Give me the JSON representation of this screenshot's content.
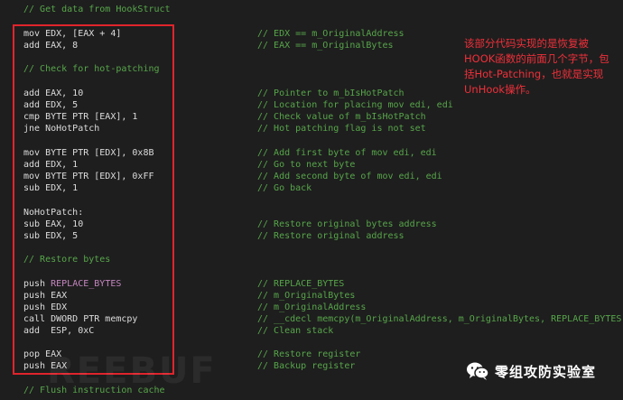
{
  "code_lines": [
    {
      "code": "// Get data from HookStruct",
      "comment": ""
    },
    {
      "code": "mov EDX, [EAX + 4]",
      "comment": "// EDX == m_OriginalAddress"
    },
    {
      "code": "add EAX, 8",
      "comment": "// EAX == m_OriginalBytes"
    },
    {
      "code": "// Check for hot-patching",
      "comment": ""
    },
    {
      "code": "add EAX, 10",
      "comment": "// Pointer to m_bIsHotPatch"
    },
    {
      "code": "add EDX, 5",
      "comment": "// Location for placing mov edi, edi"
    },
    {
      "code": "cmp BYTE PTR [EAX], 1",
      "comment": "// Check value of m_bIsHotPatch"
    },
    {
      "code": "jne NoHotPatch",
      "comment": "// Hot patching flag is not set"
    },
    {
      "code": "mov BYTE PTR [EDX], 0x8B",
      "comment": "// Add first byte of mov edi, edi"
    },
    {
      "code": "add EDX, 1",
      "comment": "// Go to next byte"
    },
    {
      "code": "mov BYTE PTR [EDX], 0xFF",
      "comment": "// Add second byte of mov edi, edi"
    },
    {
      "code": "sub EDX, 1",
      "comment": "// Go back"
    },
    {
      "code": "NoHotPatch:",
      "comment": ""
    },
    {
      "code": "sub EAX, 10",
      "comment": "// Restore original bytes address"
    },
    {
      "code": "sub EDX, 5",
      "comment": "// Restore original address"
    },
    {
      "code": "// Restore bytes",
      "comment": ""
    },
    {
      "code": "push ",
      "code_kw": "REPLACE_BYTES",
      "comment": "// REPLACE_BYTES"
    },
    {
      "code": "push EAX",
      "comment": "// m_OriginalBytes"
    },
    {
      "code": "push EDX",
      "comment": "// m_OriginalAddress"
    },
    {
      "code": "call DWORD PTR memcpy",
      "comment": "// __cdecl memcpy(m_OriginalAddress, m_OriginalBytes, REPLACE_BYTES)"
    },
    {
      "code": "add  ESP, 0xC",
      "comment": "// Clean stack"
    },
    {
      "code": "pop EAX",
      "comment": "// Restore register"
    },
    {
      "code": "push EAX",
      "comment": "// Backup register"
    },
    {
      "code": "// Flush instruction cache",
      "comment": ""
    }
  ],
  "annotation": "该部分代码实现的是恢复被HOOK函数的前面几个字节，包括Hot-Patching，也就是实现UnHook操作。",
  "watermark": "REEBUF",
  "badge": {
    "text": "零组攻防实验室",
    "icon": "wechat-icon"
  },
  "colors": {
    "background": "#1e1e1e",
    "code": "#dcdcdc",
    "comment": "#57a64a",
    "keyword": "#c586c0",
    "highlight": "#e0242c",
    "annotation": "#f0303a"
  }
}
